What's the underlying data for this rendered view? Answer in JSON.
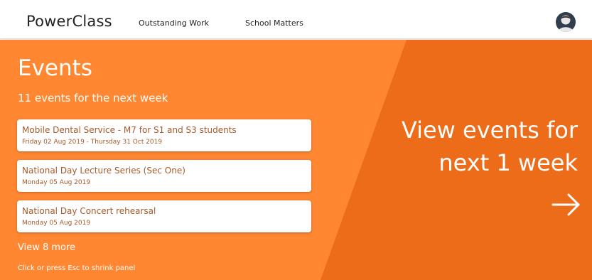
{
  "app": {
    "brand": "PowerClass"
  },
  "nav": {
    "items": [
      "Outstanding Work",
      "School Matters"
    ]
  },
  "events_panel": {
    "title": "Events",
    "count_text": "11 events for the next week",
    "events": [
      {
        "name": "Mobile Dental Service - M7 for S1 and S3 students",
        "date": "Friday 02 Aug 2019 - Thursday 31 Oct 2019"
      },
      {
        "name": "National Day Lecture Series (Sec One)",
        "date": "Monday 05 Aug 2019"
      },
      {
        "name": "National Day Concert rehearsal",
        "date": "Monday 05 Aug 2019"
      }
    ],
    "view_more": "View 8 more",
    "hint": "Click or press Esc to shrink panel",
    "cta_line1": "View events for",
    "cta_line2": "next 1 week",
    "arrow_icon": "arrow-right-icon"
  },
  "colors": {
    "panel_light": "#ff8732",
    "panel_dark": "#ed6c19",
    "event_text": "#a65a2a",
    "avatar_bg": "#2f3d4f"
  }
}
